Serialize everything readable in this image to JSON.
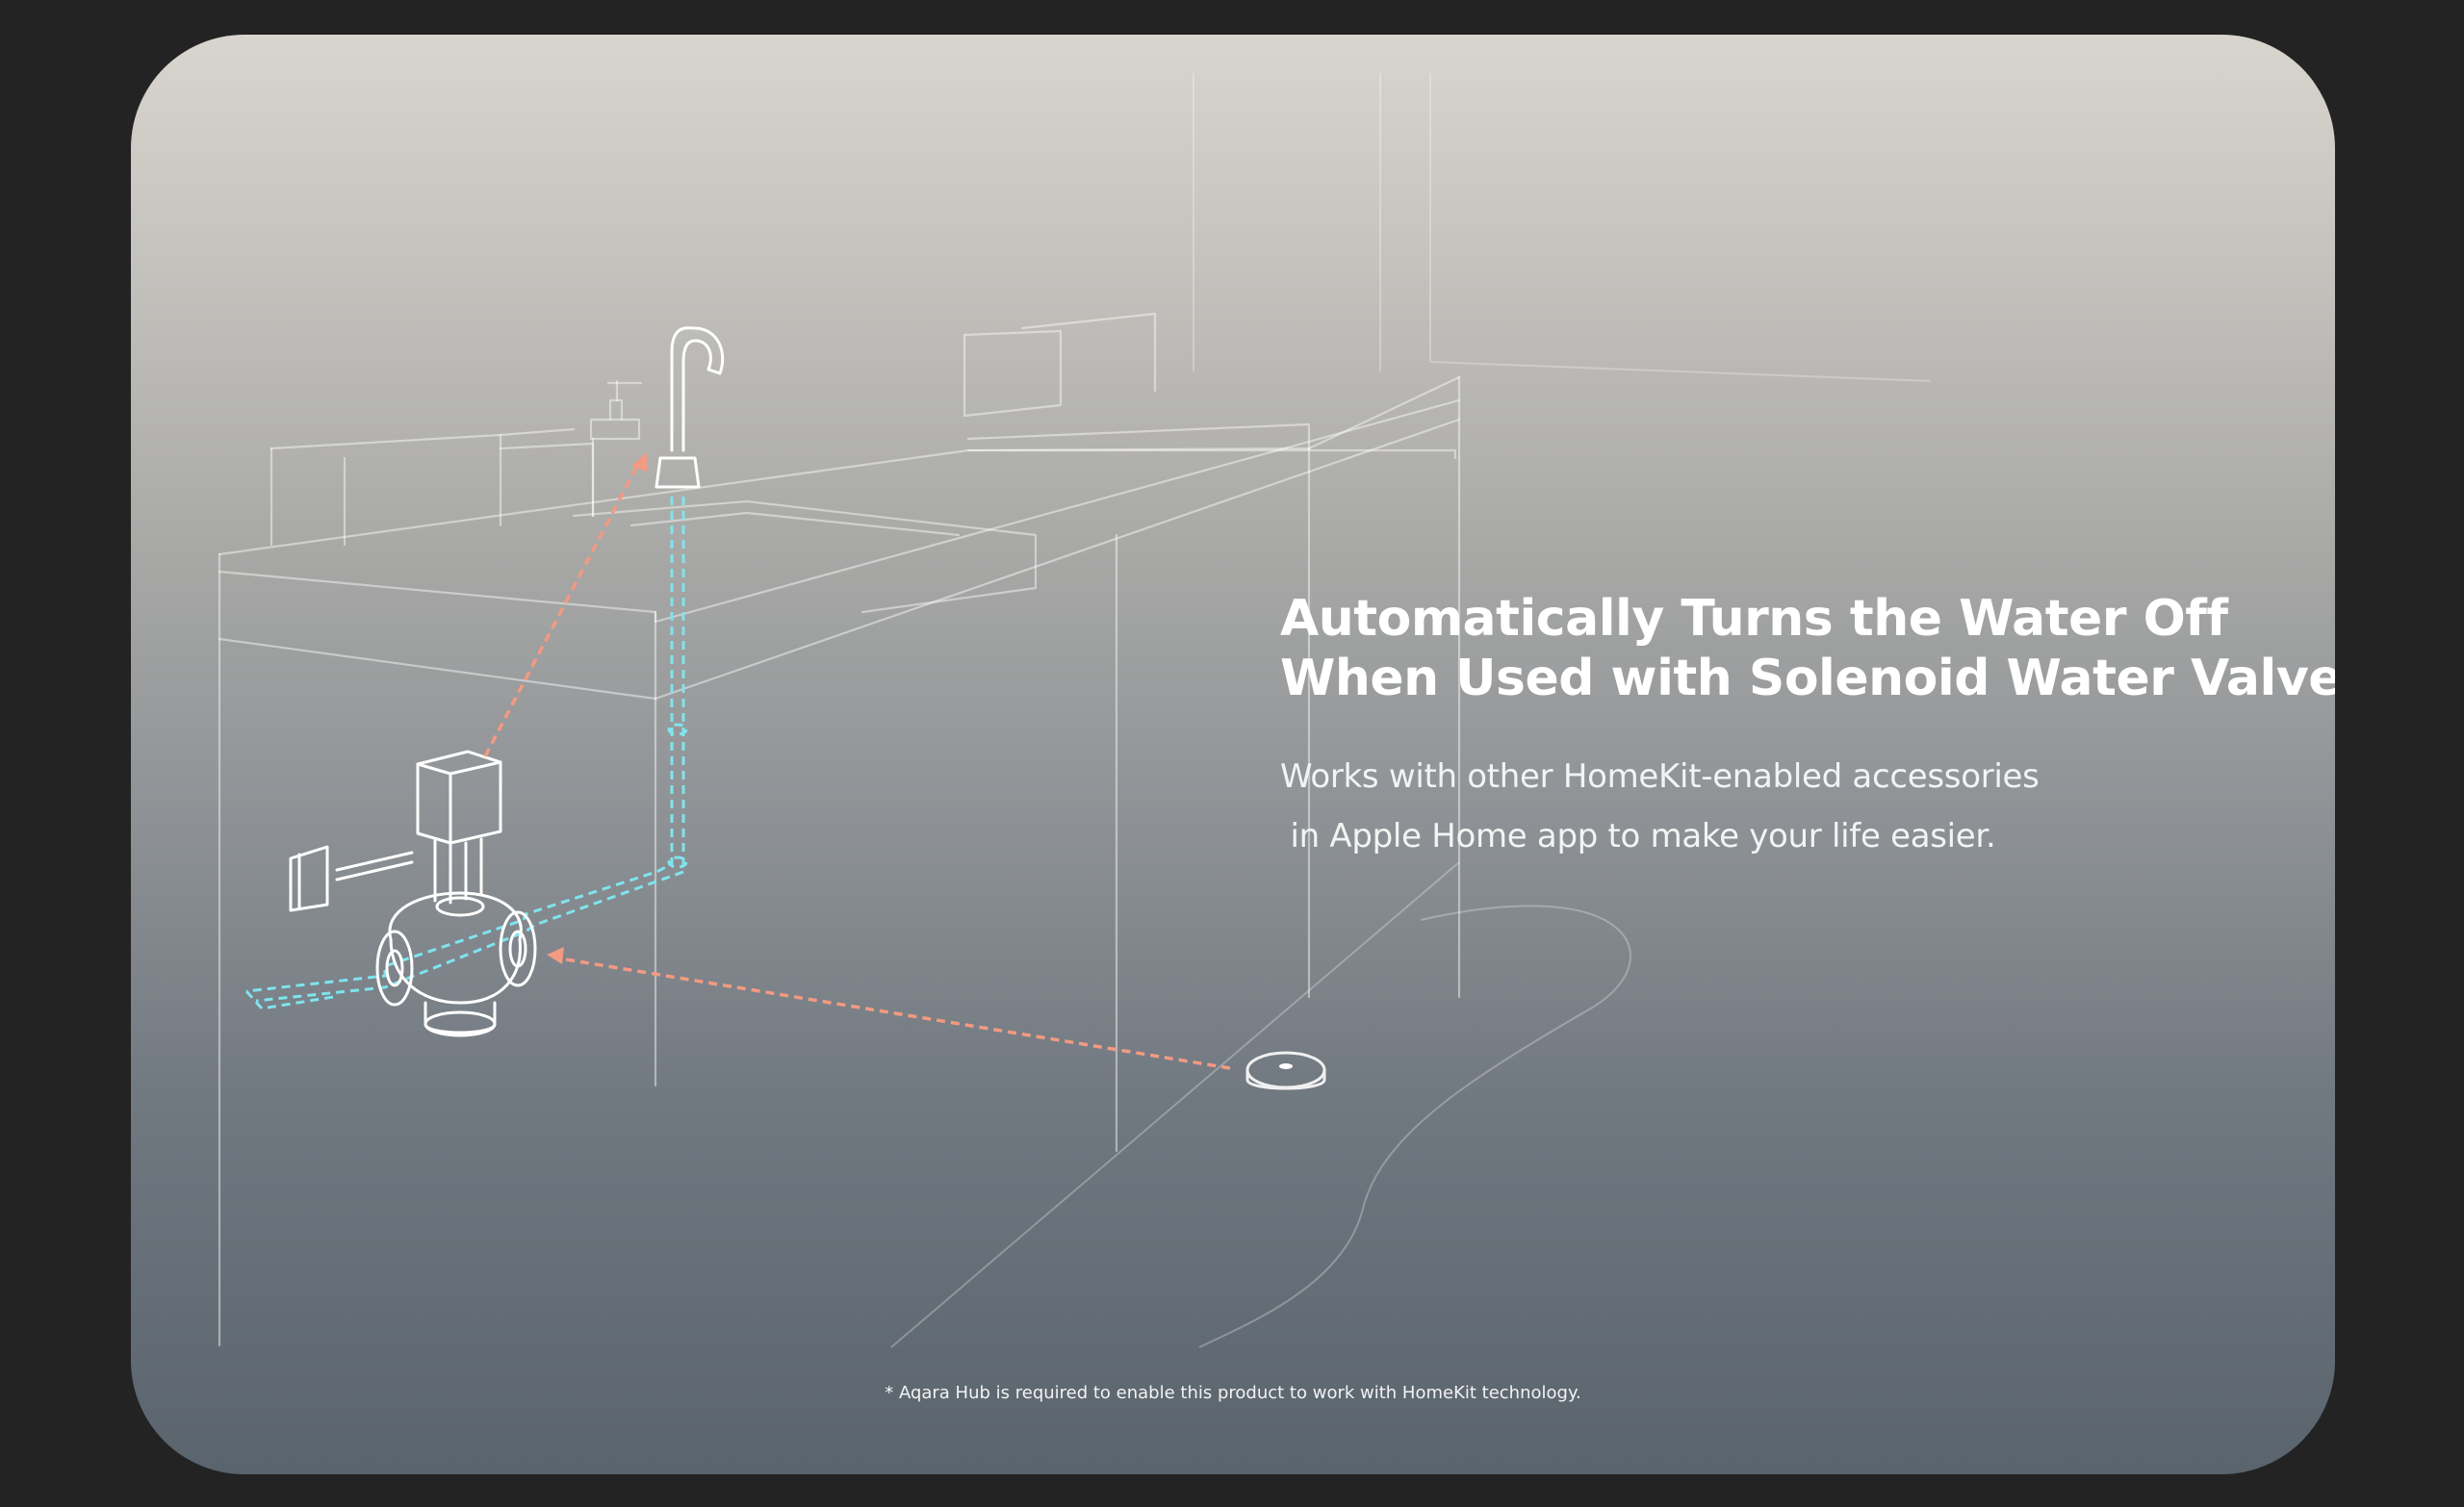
{
  "headline": {
    "line1": "Automatically Turns the Water Off",
    "line2": "When Used with Solenoid Water Valve"
  },
  "subtext": {
    "line1": "Works with other HomeKit-enabled accessories",
    "line2": " in Apple Home app to make your life easier."
  },
  "footnote": "* Aqara Hub is required to enable this product to work with HomeKit technology.",
  "colors": {
    "page_background": "#232323",
    "gradient_top": "#d8d5ce",
    "gradient_bottom": "#5a646d",
    "pipe_dash": "#7fe4ee",
    "signal_arrow": "#f29a82",
    "text": "#ffffff"
  },
  "icons": [
    "faucet-icon",
    "soap-dispenser-icon",
    "solenoid-valve-icon",
    "water-leak-sensor-icon"
  ]
}
